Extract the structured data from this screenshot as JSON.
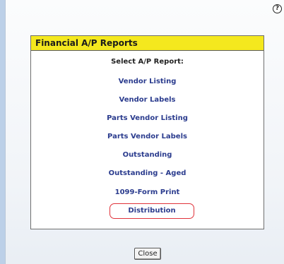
{
  "help_icon": {
    "glyph": "?"
  },
  "panel": {
    "title": "Financial A/P Reports",
    "subtitle": "Select A/P Report:",
    "items": [
      {
        "label": "Vendor Listing"
      },
      {
        "label": "Vendor Labels"
      },
      {
        "label": "Parts Vendor Listing"
      },
      {
        "label": "Parts Vendor Labels"
      },
      {
        "label": "Outstanding"
      },
      {
        "label": "Outstanding - Aged"
      },
      {
        "label": "1099-Form Print"
      },
      {
        "label": "Distribution"
      }
    ]
  },
  "footer": {
    "close_label": "Close"
  },
  "colors": {
    "header_bg": "#f4e81e",
    "link": "#2b3c8e",
    "highlight_border": "#e0323a"
  }
}
